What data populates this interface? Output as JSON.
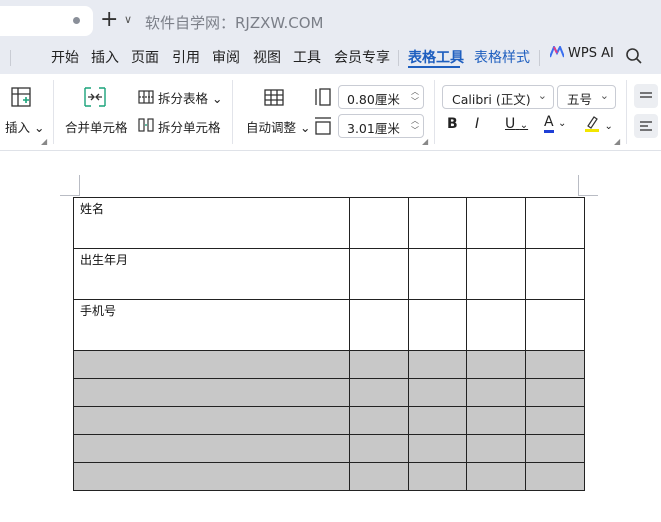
{
  "titlebar": {
    "new_tab_symbol": "+",
    "dropdown_symbol": "∨",
    "title": "软件自学网：RJZXW.COM"
  },
  "menu": {
    "items": [
      "开始",
      "插入",
      "页面",
      "引用",
      "审阅",
      "视图",
      "工具",
      "会员专享",
      "表格工具",
      "表格样式"
    ],
    "active": "表格工具",
    "wps_ai": "WPS AI"
  },
  "ribbon": {
    "insert_label": "插入",
    "merge_label": "合并单元格",
    "split_table_label": "拆分表格",
    "split_cells_label": "拆分单元格",
    "autofit_label": "自动调整",
    "cell_width": "0.80厘米",
    "cell_height": "3.01厘米",
    "font_name": "Calibri (正文)",
    "font_size": "五号",
    "bold": "B",
    "italic": "I",
    "underline": "U",
    "font_color_letter": "A",
    "font_color": "#1f3fd6",
    "highlight_color": "#f2e600",
    "accent_color": "#1f5fbf"
  },
  "table": {
    "row_labels": [
      "姓名",
      "出生年月",
      "手机号"
    ],
    "columns": 5,
    "empty_rows_shaded": 5,
    "shade_color": "#c8c8c8"
  }
}
